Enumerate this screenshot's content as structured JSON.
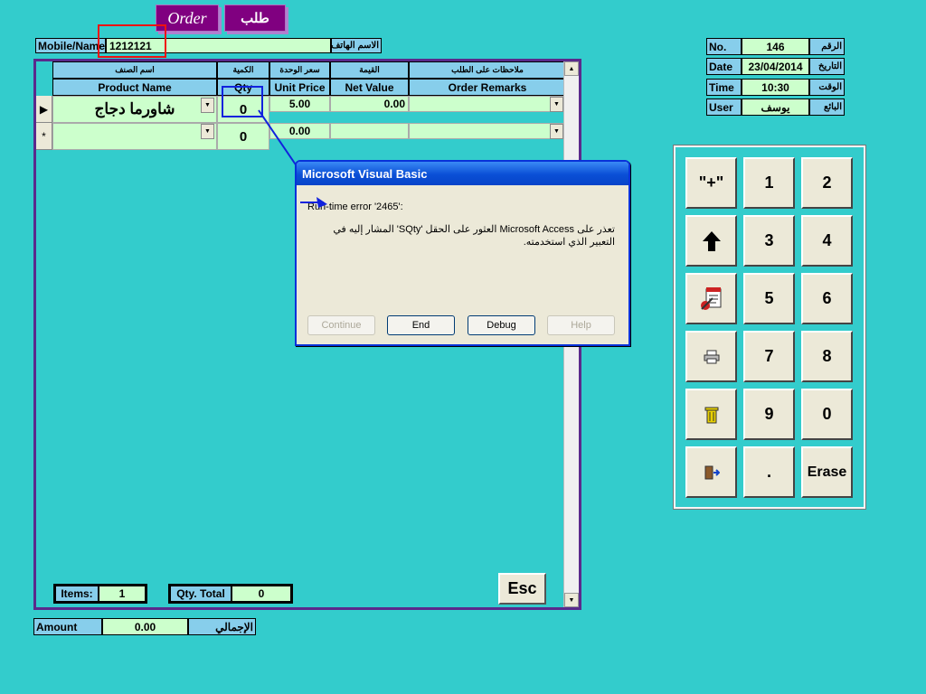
{
  "tabs": {
    "order_en": "Order",
    "order_ar": "طلب"
  },
  "mobile": {
    "label": "Mobile/Name",
    "value": "1212121",
    "label_ar": "الاسم الهاتف"
  },
  "info": {
    "no": {
      "label": "No.",
      "value": "146",
      "label_ar": "الرقم"
    },
    "date": {
      "label": "Date",
      "value": "23/04/2014",
      "label_ar": "التاريخ"
    },
    "time": {
      "label": "Time",
      "value": "10:30",
      "label_ar": "الوقت"
    },
    "user": {
      "label": "User",
      "value": "يوسف",
      "label_ar": "البائع"
    }
  },
  "grid": {
    "headers_ar": [
      "اسم الصنف",
      "الكمية",
      "سعر الوحدة",
      "القيمة",
      "ملاحظات على الطلب"
    ],
    "headers": [
      "Product Name",
      "Qty",
      "Unit Price",
      "Net Value",
      "Order Remarks"
    ],
    "rows": [
      {
        "selector": "▶",
        "product": "شاورما دجاج",
        "qty": "0",
        "unit_price": "5.00",
        "net_value": "0.00",
        "remarks": ""
      },
      {
        "selector": "*",
        "product": "",
        "qty": "0",
        "unit_price": "0.00",
        "net_value": "",
        "remarks": ""
      }
    ]
  },
  "totals": {
    "items_label": "Items:",
    "items_value": "1",
    "qty_label": "Qty. Total",
    "qty_value": "0"
  },
  "esc_label": "Esc",
  "amount": {
    "label": "Amount",
    "value": "0.00",
    "label_ar": "الإجمالي"
  },
  "keypad": {
    "keys": [
      "\"+\"",
      "1",
      "2",
      "",
      "3",
      "4",
      "",
      "5",
      "6",
      "",
      "7",
      "8",
      "",
      "9",
      "0",
      "",
      ".",
      "Erase"
    ],
    "icons": [
      "up-arrow-icon",
      "notepad-icon",
      "printer-icon",
      "trash-icon",
      "exit-door-icon"
    ]
  },
  "dialog": {
    "title": "Microsoft Visual Basic",
    "error": "Run-time error '2465':",
    "message": "تعذر على Microsoft Access العثور على الحقل 'SQty' المشار إليه في التعبير الذي استخدمته.",
    "buttons": [
      "Continue",
      "End",
      "Debug",
      "Help"
    ]
  },
  "colors": {
    "background": "#33cccc",
    "label": "#87ceeb",
    "value": "#ccffcc",
    "tab": "#800080",
    "highlight_red": "#ee1111",
    "highlight_blue": "#1122dd"
  }
}
